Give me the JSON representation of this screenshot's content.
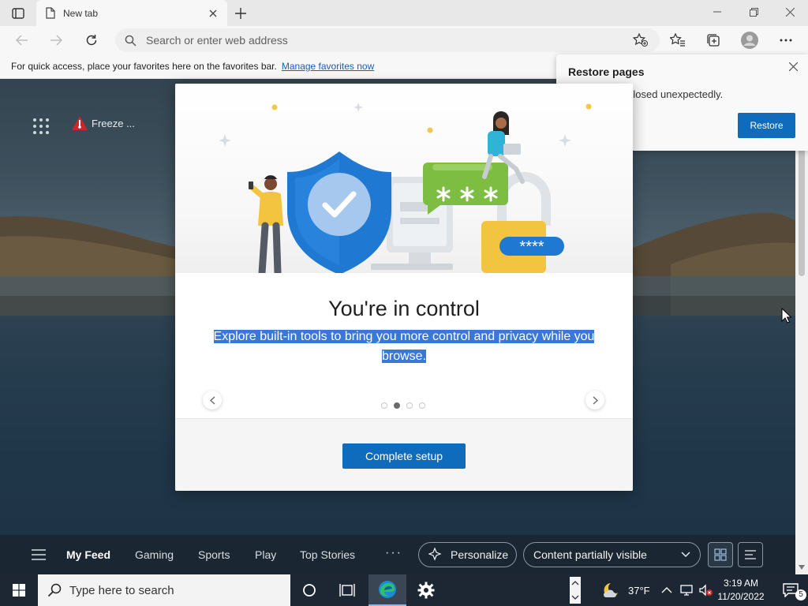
{
  "browser": {
    "tab_title": "New tab",
    "address_placeholder": "Search or enter web address",
    "favorites_prompt": "For quick access, place your favorites here on the favorites bar.",
    "favorites_link": "Manage favorites now"
  },
  "newtab": {
    "weather_label": "Freeze ..."
  },
  "restore_popup": {
    "title": "Restore pages",
    "message": "e closed unexpectedly.",
    "button": "Restore"
  },
  "modal": {
    "title": "You're in control",
    "subtitle": "Explore built-in tools to bring you more control and privacy while you browse.",
    "password_dots": "****",
    "cta": "Complete setup",
    "pager": {
      "total": 4,
      "active": 2
    }
  },
  "feed": {
    "tabs": [
      "My Feed",
      "Gaming",
      "Sports",
      "Play",
      "Top Stories"
    ],
    "more": "···",
    "personalize": "Personalize",
    "content_visibility": "Content partially visible"
  },
  "taskbar": {
    "search_placeholder": "Type here to search",
    "temperature": "37°F",
    "time": "3:19 AM",
    "date": "11/20/2022",
    "notification_count": "5"
  },
  "colors": {
    "accent": "#0f6cbd",
    "selection": "#3a78d8",
    "shield": "#1f78d1",
    "lock": "#f3c43f",
    "chat_bubble": "#7cbd42"
  }
}
